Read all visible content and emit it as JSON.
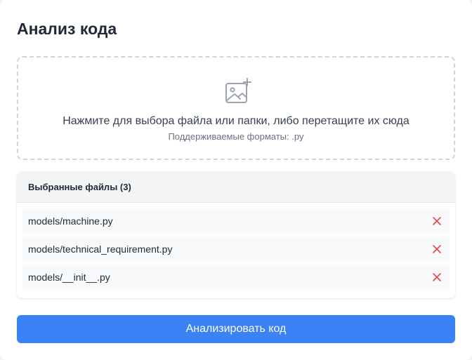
{
  "page": {
    "title": "Анализ кода"
  },
  "dropzone": {
    "icon": "image-add-icon",
    "main_text": "Нажмите для выбора файла или папки, либо перетащите их сюда",
    "sub_text": "Поддерживаемые форматы: .py"
  },
  "files": {
    "header": "Выбранные файлы (3)",
    "items": [
      {
        "name": "models/machine.py"
      },
      {
        "name": "models/technical_requirement.py"
      },
      {
        "name": "models/__init__.py"
      }
    ],
    "remove_icon": "close-icon",
    "remove_color": "#ef4444"
  },
  "actions": {
    "analyze_label": "Анализировать код"
  },
  "colors": {
    "accent": "#3b82f6",
    "text": "#1f2937",
    "muted": "#6b7280"
  }
}
